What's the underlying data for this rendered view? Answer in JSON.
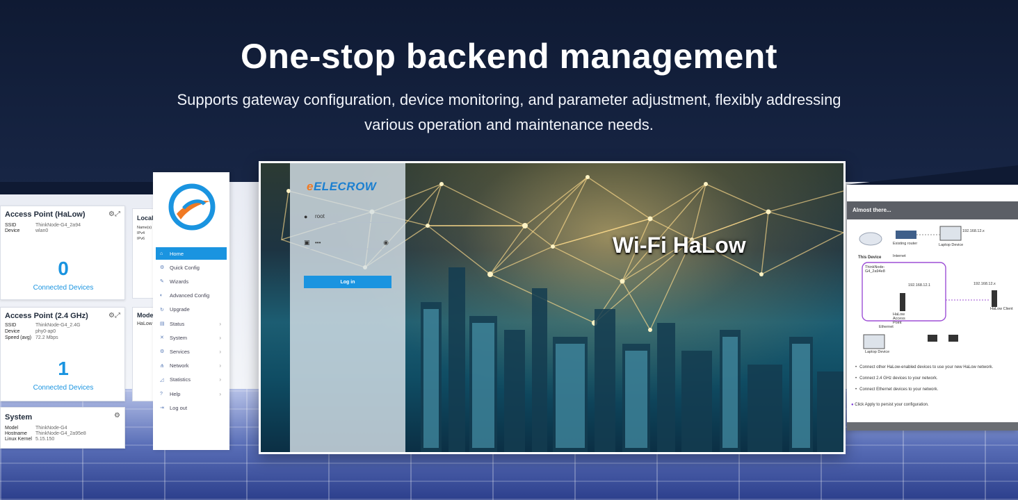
{
  "hero": {
    "title": "One-stop backend management",
    "subtitle_line1": "Supports gateway configuration, device monitoring, and parameter adjustment, flexibly addressing",
    "subtitle_line2": "various operation and maintenance needs."
  },
  "cards": {
    "halow": {
      "title": "Access Point (HaLow)",
      "rows": [
        {
          "k": "SSID",
          "v": "ThinkNode-G4_2a94"
        },
        {
          "k": "Device",
          "v": "wlan0"
        }
      ],
      "count": "0",
      "count_label": "Connected Devices"
    },
    "ap24": {
      "title": "Access Point (2.4 GHz)",
      "rows": [
        {
          "k": "SSID",
          "v": "ThinkNode-G4_2.4G"
        },
        {
          "k": "Device",
          "v": "phy0-ap0"
        },
        {
          "k": "Speed (avg)",
          "v": "72.2 Mbps"
        }
      ],
      "count": "1",
      "count_label": "Connected Devices"
    },
    "system": {
      "title": "System",
      "rows": [
        {
          "k": "Model",
          "v": "ThinkNode-G4"
        },
        {
          "k": "Hostname",
          "v": "ThinkNode-G4_2a95e8"
        },
        {
          "k": "Linux Kernel",
          "v": "5.15.150"
        }
      ]
    },
    "peek_local": {
      "title": "Local",
      "lines": [
        "Name(s)",
        "IPv4",
        "IPv6"
      ]
    },
    "peek_mode": {
      "title": "Mode",
      "line": "HaLow"
    }
  },
  "menu": {
    "items": [
      {
        "label": "Home",
        "icon": "home-icon",
        "glyph": "⌂",
        "active": true,
        "chevron": false
      },
      {
        "label": "Quick Config",
        "icon": "quick-config-icon",
        "glyph": "⚙",
        "active": false,
        "chevron": false
      },
      {
        "label": "Wizards",
        "icon": "wizard-icon",
        "glyph": "✎",
        "active": false,
        "chevron": false
      },
      {
        "label": "Advanced Config",
        "icon": "advanced-config-icon",
        "glyph": "◐",
        "active": false,
        "chevron": false
      },
      {
        "label": "Upgrade",
        "icon": "upgrade-icon",
        "glyph": "↻",
        "active": false,
        "chevron": false
      },
      {
        "label": "Status",
        "icon": "status-icon",
        "glyph": "▤",
        "active": false,
        "chevron": true
      },
      {
        "label": "System",
        "icon": "system-icon",
        "glyph": "✕",
        "active": false,
        "chevron": true
      },
      {
        "label": "Services",
        "icon": "services-icon",
        "glyph": "⚙",
        "active": false,
        "chevron": true
      },
      {
        "label": "Network",
        "icon": "network-icon",
        "glyph": "⋔",
        "active": false,
        "chevron": true
      },
      {
        "label": "Statistics",
        "icon": "statistics-icon",
        "glyph": "◿",
        "active": false,
        "chevron": true
      },
      {
        "label": "Help",
        "icon": "help-icon",
        "glyph": "?",
        "active": false,
        "chevron": true
      },
      {
        "label": "Log out",
        "icon": "logout-icon",
        "glyph": "⇥",
        "active": false,
        "chevron": false
      }
    ],
    "chevron_glyph": "›"
  },
  "login": {
    "brand": "ELECROW",
    "brand_mark": "e",
    "username": "root",
    "password_mask": "•••",
    "button": "Log in",
    "eye_glyph": "◉",
    "user_glyph": "●",
    "lock_glyph": "▣",
    "banner": "Wi-Fi HaLow"
  },
  "wizard": {
    "header": "Almost there...",
    "diagram": {
      "this_device": "This Device",
      "device_name": "ThinkNode-G4_2a94e8",
      "existing_router": "Existing router",
      "laptop_device": "Laptop Device",
      "internet": "Internet",
      "ip_a": "192.168.12.x",
      "ip_b": "192.168.12.1",
      "ip_c": "192.168.12.x",
      "halow_client": "HaLow Client",
      "halow_access_point": "HaLow Access Point",
      "ethernet": "Ethernet"
    },
    "lines": [
      "Connect other HaLow-enabled devices to use your new HaLow network.",
      "Connect 2.4 GHz devices to your network.",
      "Connect Ethernet devices to your network."
    ],
    "note": "Click Apply to persist your configuration."
  },
  "colors": {
    "accent": "#1a94e0",
    "brand_orange": "#f07a24",
    "background": "#172544"
  }
}
